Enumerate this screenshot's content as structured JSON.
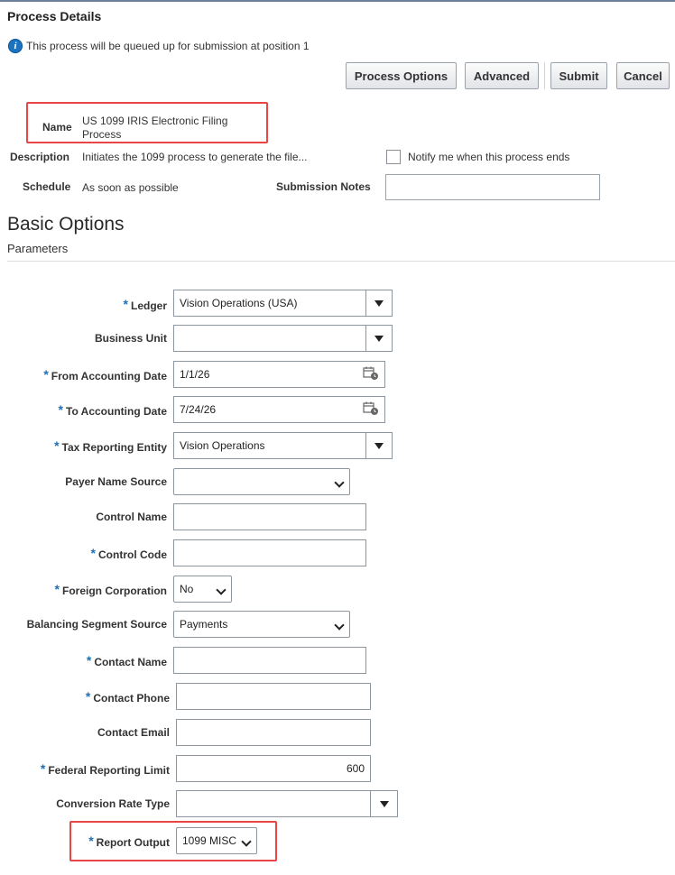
{
  "header": {
    "title": "Process Details",
    "info_icon": "i",
    "info_text": "This process will be queued up for submission at position 1"
  },
  "toolbar": {
    "process_options": "Process Options",
    "advanced": "Advanced",
    "submit": "Submit",
    "cancel": "Cancel"
  },
  "details": {
    "name_label": "Name",
    "name_line1": "US 1099 IRIS Electronic Filing",
    "name_line2": "Process",
    "description_label": "Description",
    "description_value": "Initiates the 1099 process to generate the file...",
    "notify_label": "Notify me when this process ends",
    "schedule_label": "Schedule",
    "schedule_value": "As soon as possible",
    "submission_notes_label": "Submission Notes",
    "submission_notes_value": ""
  },
  "basic_options": {
    "heading": "Basic Options",
    "subheading": "Parameters"
  },
  "params": {
    "ledger": {
      "label": "Ledger",
      "value": "Vision Operations (USA)"
    },
    "business_unit": {
      "label": "Business Unit",
      "value": ""
    },
    "from_date": {
      "label": "From Accounting Date",
      "value": "1/1/26"
    },
    "to_date": {
      "label": "To Accounting Date",
      "value": "7/24/26"
    },
    "tax_entity": {
      "label": "Tax Reporting Entity",
      "value": "Vision Operations"
    },
    "payer_name_source": {
      "label": "Payer Name Source",
      "value": ""
    },
    "control_name": {
      "label": "Control Name",
      "value": ""
    },
    "control_code": {
      "label": "Control Code",
      "value": ""
    },
    "foreign_corp": {
      "label": "Foreign Corporation",
      "value": "No"
    },
    "balancing_segment": {
      "label": "Balancing Segment Source",
      "value": "Payments"
    },
    "contact_name": {
      "label": "Contact Name",
      "value": ""
    },
    "contact_phone": {
      "label": "Contact Phone",
      "value": ""
    },
    "contact_email": {
      "label": "Contact Email",
      "value": ""
    },
    "federal_limit": {
      "label": "Federal Reporting Limit",
      "value": "600"
    },
    "conversion_rate": {
      "label": "Conversion Rate Type",
      "value": ""
    },
    "report_output": {
      "label": "Report Output",
      "value": "1099 MISC"
    }
  },
  "required_marker": "*",
  "colors": {
    "highlight": "#e84545",
    "required": "#1f6fb8",
    "info": "#1e73be"
  },
  "icons": [
    "info-icon",
    "calendar-icon",
    "dropdown-arrow-icon",
    "chevron-down-icon"
  ]
}
